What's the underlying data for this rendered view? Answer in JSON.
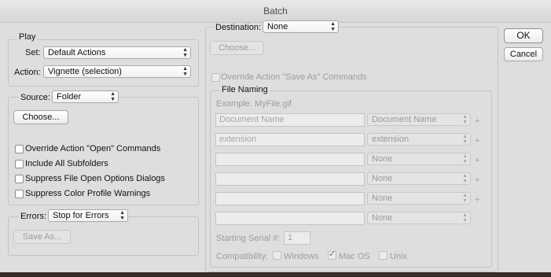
{
  "window": {
    "title": "Batch"
  },
  "play": {
    "legend": "Play",
    "set_label": "Set:",
    "set_value": "Default Actions",
    "action_label": "Action:",
    "action_value": "Vignette (selection)"
  },
  "source": {
    "label": "Source:",
    "value": "Folder",
    "choose": "Choose...",
    "options": [
      "Override Action \"Open\" Commands",
      "Include All Subfolders",
      "Suppress File Open Options Dialogs",
      "Suppress Color Profile Warnings"
    ]
  },
  "errors": {
    "label": "Errors:",
    "value": "Stop for Errors",
    "save_as": "Save As..."
  },
  "destination": {
    "label": "Destination:",
    "value": "None",
    "choose": "Choose...",
    "override": "Override Action \"Save As\" Commands"
  },
  "file_naming": {
    "legend": "File Naming",
    "example": "Example: MyFile.gif",
    "rows": [
      {
        "text": "Document Name",
        "select": "Document Name"
      },
      {
        "text": "extension",
        "select": "extension"
      },
      {
        "text": "",
        "select": "None"
      },
      {
        "text": "",
        "select": "None"
      },
      {
        "text": "",
        "select": "None"
      },
      {
        "text": "",
        "select": "None"
      }
    ],
    "plus": "+",
    "serial_label": "Starting Serial #:",
    "serial_value": "1",
    "compat_label": "Compatibility:",
    "compat": [
      {
        "label": "Windows",
        "checked": false
      },
      {
        "label": "Mac OS",
        "checked": true
      },
      {
        "label": "Unix",
        "checked": false
      }
    ]
  },
  "buttons": {
    "ok": "OK",
    "cancel": "Cancel"
  }
}
